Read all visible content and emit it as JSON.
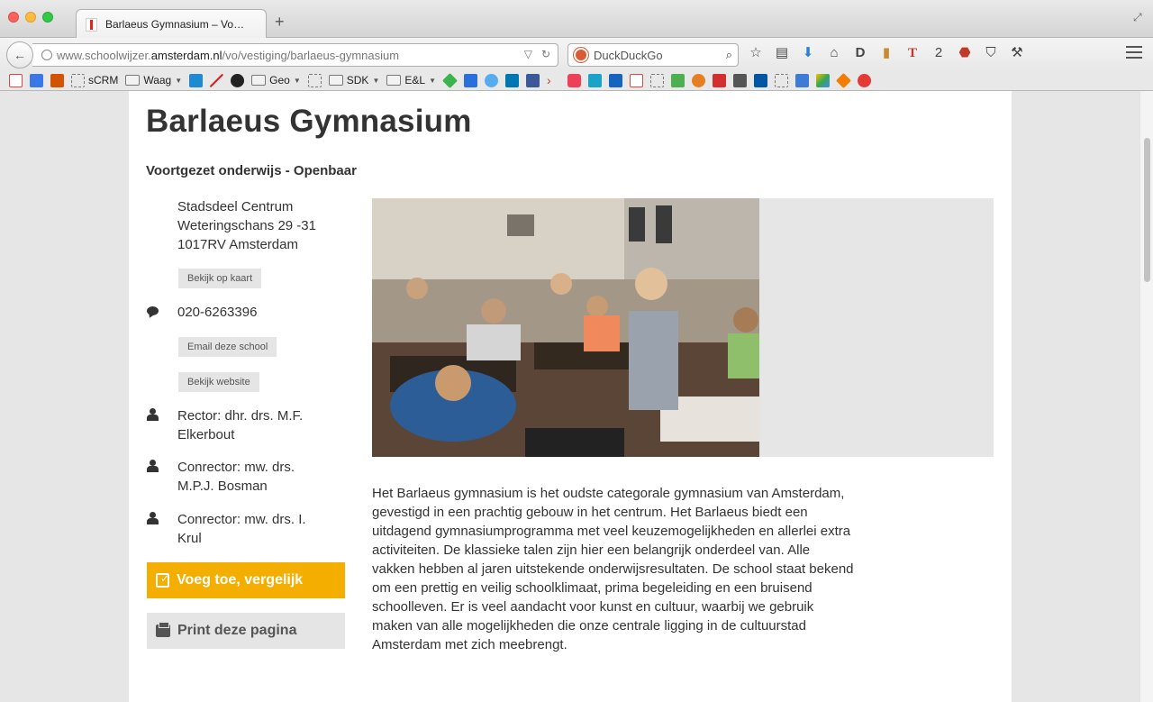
{
  "browser": {
    "tab_title": "Barlaeus Gymnasium – Vo…",
    "url_prefix": "www.schoolwijzer.",
    "url_domain": "amsterdam.nl",
    "url_path": "/vo/vestiging/barlaeus-gymnasium",
    "search_engine": "DuckDuckGo",
    "bookmarks": [
      {
        "label": "sCRM"
      },
      {
        "label": "Waag"
      },
      {
        "label": "Geo"
      },
      {
        "label": "SDK"
      },
      {
        "label": "E&L"
      }
    ]
  },
  "school": {
    "name": "Barlaeus Gymnasium",
    "type": "Voortgezet onderwijs - Openbaar",
    "address": {
      "district": "Stadsdeel Centrum",
      "street": "Weteringschans 29 -31",
      "postal_city": "1017RV Amsterdam",
      "map_button": "Bekijk op kaart"
    },
    "phone": "020-6263396",
    "email_button": "Email deze school",
    "website_button": "Bekijk website",
    "staff": [
      {
        "line1": "Rector: dhr. drs. M.F.",
        "line2": "Elkerbout"
      },
      {
        "line1": "Conrector:  mw. drs.",
        "line2": "M.P.J. Bosman"
      },
      {
        "line1": "Conrector:  mw. drs. I.",
        "line2": "Krul"
      }
    ],
    "compare_button": "Voeg toe, vergelijk",
    "print_button": "Print deze pagina",
    "description": "Het Barlaeus gymnasium is het oudste categorale gymnasium van Amsterdam, gevestigd in een prachtig gebouw in het centrum. Het Barlaeus biedt een uitdagend gymnasiumprogramma met veel keuzemogelijkheden en allerlei extra activiteiten. De klassieke talen zijn hier een belangrijk onderdeel van. Alle vakken hebben al jaren uitstekende onderwijsresultaten. De school staat bekend om een prettig en veilig schoolklimaat, prima begeleiding en een bruisend schoolleven. Er is veel aandacht voor kunst en cultuur, waarbij we gebruik maken van alle mogelijkheden die onze centrale ligging in de cultuurstad Amsterdam met zich meebrengt."
  },
  "colors": {
    "accent": "#f4ae00",
    "button_gray": "#e5e5e5",
    "text": "#333333"
  }
}
